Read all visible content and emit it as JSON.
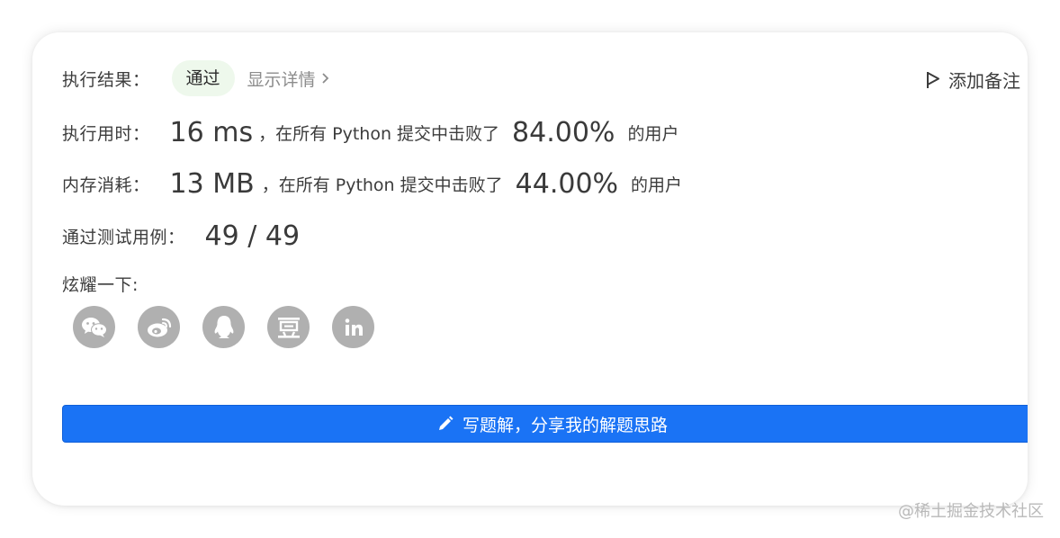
{
  "result": {
    "label": "执行结果：",
    "status": "通过",
    "details_link": "显示详情",
    "add_note": "添加备注"
  },
  "runtime": {
    "label": "执行用时：",
    "value": "16 ms",
    "beat_text": "，在所有 Python 提交中击败了",
    "percent": "84.00%",
    "suffix": "的用户"
  },
  "memory": {
    "label": "内存消耗：",
    "value": "13 MB",
    "beat_text": "，在所有 Python 提交中击败了",
    "percent": "44.00%",
    "suffix": "的用户"
  },
  "testcases": {
    "label": "通过测试用例：",
    "value": "49 / 49"
  },
  "share": {
    "label": "炫耀一下:",
    "icons": [
      "wechat-icon",
      "weibo-icon",
      "qq-icon",
      "douban-icon",
      "linkedin-icon"
    ]
  },
  "write_solution": {
    "label": "写题解，分享我的解题思路"
  },
  "watermark": "@稀土掘金技术社区",
  "colors": {
    "accent": "#1a73f5",
    "badge_bg": "#eef8ec",
    "icon_gray": "#b0b0b0"
  }
}
